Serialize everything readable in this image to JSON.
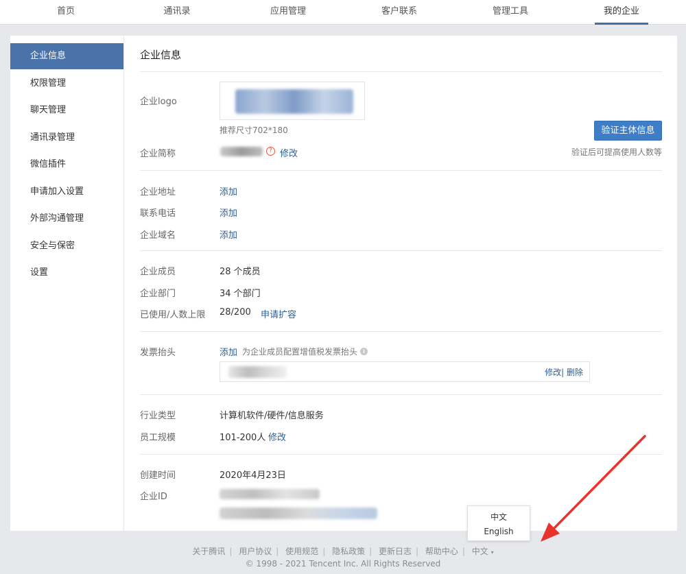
{
  "topnav": {
    "tabs": [
      "首页",
      "通讯录",
      "应用管理",
      "客户联系",
      "管理工具",
      "我的企业"
    ],
    "active_index": 5
  },
  "sidebar": {
    "items": [
      "企业信息",
      "权限管理",
      "聊天管理",
      "通讯录管理",
      "微信插件",
      "申请加入设置",
      "外部沟通管理",
      "安全与保密",
      "设置"
    ],
    "active_index": 0
  },
  "content": {
    "heading": "企业信息",
    "logo": {
      "label": "企业logo",
      "size_hint": "推荐尺寸702*180"
    },
    "verify": {
      "button_label": "验证主体信息",
      "hint": "验证后可提高使用人数等"
    },
    "short_name": {
      "label": "企业简称",
      "help_glyph": "?",
      "edit_label": "修改"
    },
    "address": {
      "label": "企业地址",
      "action": "添加"
    },
    "phone": {
      "label": "联系电话",
      "action": "添加"
    },
    "domain": {
      "label": "企业域名",
      "action": "添加"
    },
    "members": {
      "label": "企业成员",
      "value": "28 个成员"
    },
    "departments": {
      "label": "企业部门",
      "value": "34 个部门"
    },
    "usage": {
      "label": "已使用/人数上限",
      "value": "28/200",
      "action": "申请扩容"
    },
    "invoice": {
      "label": "发票抬头",
      "action": "添加",
      "hint": "为企业成员配置增值税发票抬头",
      "info_glyph": "i",
      "row_actions": "修改| 删除"
    },
    "industry": {
      "label": "行业类型",
      "value": "计算机软件/硬件/信息服务"
    },
    "scale": {
      "label": "员工规模",
      "value": "101-200人",
      "action": "修改"
    },
    "created": {
      "label": "创建时间",
      "value": "2020年4月23日"
    },
    "corp_id": {
      "label": "企业ID"
    }
  },
  "lang_menu": {
    "options": [
      "中文",
      "English"
    ]
  },
  "footer": {
    "links": [
      "关于腾讯",
      "用户协议",
      "使用规范",
      "隐私政策",
      "更新日志",
      "帮助中心"
    ],
    "language": "中文",
    "language_caret": "▾",
    "copyright": "© 1998 - 2021 Tencent Inc. All Rights Reserved"
  },
  "colors": {
    "accent": "#4a74a9",
    "primary_button": "#3f7ec7",
    "link": "#2d5f94",
    "annotation_arrow": "#e8322b"
  }
}
